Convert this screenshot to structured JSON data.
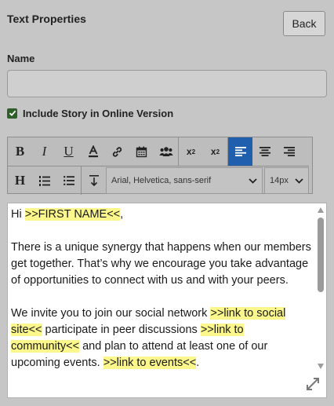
{
  "panel": {
    "title": "Text Properties",
    "back_label": "Back"
  },
  "name_field": {
    "label": "Name",
    "value": "",
    "placeholder": ""
  },
  "include_story": {
    "label": "Include Story in Online Version",
    "checked": true
  },
  "toolbar": {
    "font_family": "Arial, Helvetica, sans-serif",
    "font_size": "14px",
    "active_button": "align-left",
    "accent_color": "#1f5fae"
  },
  "editor": {
    "p1": {
      "text": "Hi ",
      "token": ">>FIRST NAME<<",
      "after": ","
    },
    "p2": "There is a unique synergy that happens when our members get together.  That’s why we encourage you take advantage of opportunities to connect with us and with your peers.",
    "p3": {
      "t1": "We invite you to join our social network ",
      "l1": ">>link to social site<<",
      "t2": " participate in peer discussions ",
      "l2": ">>link to community<<",
      "t3": " and plan to attend at least one of our upcoming events.   ",
      "l3": ">>link to events<<",
      "t4": "."
    },
    "highlight_color": "#fbf78c"
  }
}
